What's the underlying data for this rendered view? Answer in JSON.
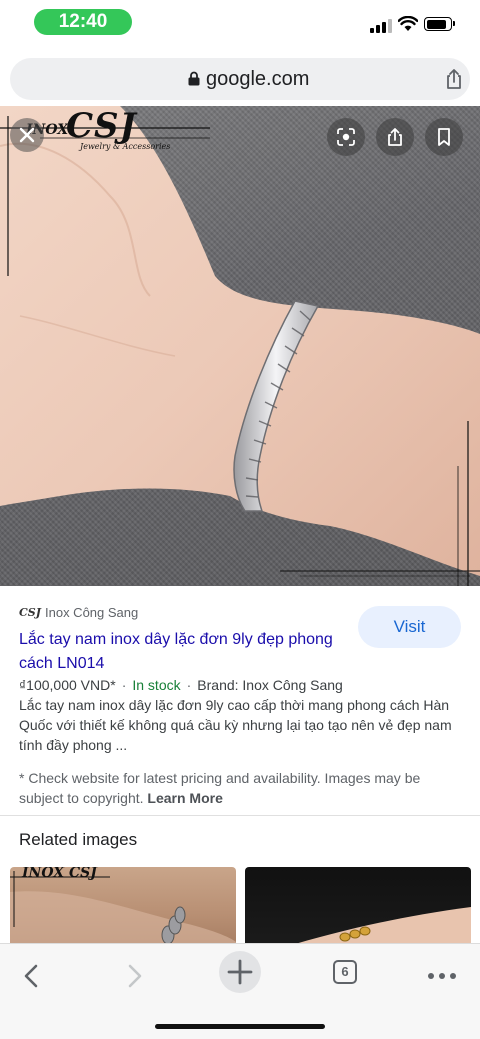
{
  "status_bar": {
    "time": "12:40"
  },
  "browser": {
    "url": "google.com",
    "tab_count": "6"
  },
  "hero": {
    "logo": {
      "brand_prefix": "INOX",
      "brand": "CSJ",
      "tagline": "Jewelry & Accessories"
    },
    "buttons": [
      "lens-icon",
      "share-icon",
      "bookmark-icon"
    ]
  },
  "product": {
    "source_logo": "CSJ",
    "source_name": "Inox Công Sang",
    "title": "Lắc tay nam inox dây lặc đơn 9ly đẹp phong cách LN014",
    "visit_label": "Visit",
    "price": "₫100,000 VND*",
    "stock": "In stock",
    "brand": "Brand: Inox Công Sang",
    "description": "Lắc tay nam inox dây lặc đơn 9ly cao cấp thời mang phong cách Hàn Quốc với thiết kế không quá cầu kỳ nhưng lại tạo tạo nên vẻ đẹp nam tính đầy phong ...",
    "disclaimer": "* Check website for latest pricing and availability. Images may be subject to copyright.",
    "learn_more": "Learn More"
  },
  "related": {
    "title": "Related images",
    "thumb1_logo": "INOX CSJ"
  },
  "colors": {
    "accent": "#1a0dab",
    "visit_bg": "#e8f0fe",
    "stock": "#188038",
    "time_pill": "#34c759"
  }
}
